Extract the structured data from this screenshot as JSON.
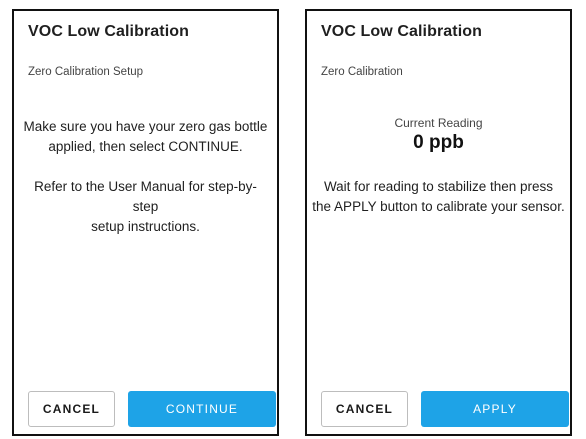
{
  "left_screen": {
    "title": "VOC Low Calibration",
    "subtitle": "Zero Calibration Setup",
    "instruction1_line1": "Make sure you have your zero gas bottle",
    "instruction1_line2": "applied, then select CONTINUE.",
    "instruction2_line1": "Refer to the User Manual for step-by-step",
    "instruction2_line2": "setup instructions.",
    "cancel_label": "CANCEL",
    "continue_label": "CONTINUE"
  },
  "right_screen": {
    "title": "VOC Low Calibration",
    "subtitle": "Zero Calibration",
    "reading_label": "Current Reading",
    "reading_value": "0 ppb",
    "instruction_line1": "Wait for reading to stabilize then press",
    "instruction_line2": "the APPLY button to calibrate your sensor.",
    "cancel_label": "CANCEL",
    "apply_label": "APPLY"
  },
  "colors": {
    "primary_button": "#1ea3e7",
    "frame_border": "#111111"
  }
}
